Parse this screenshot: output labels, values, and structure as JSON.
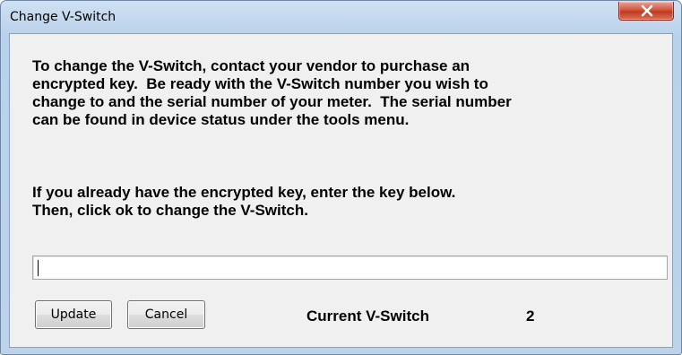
{
  "window": {
    "title": "Change V-Switch",
    "close_icon": "close-x-icon"
  },
  "message": {
    "paragraph1": "To change the V-Switch, contact your vendor to purchase an\nencrypted key.  Be ready with the V-Switch number you wish to\nchange to and the serial number of your meter.  The serial number\ncan be found in device status under the tools menu.",
    "paragraph2": "If you already have the encrypted key, enter the key below.\nThen, click ok to change the V-Switch."
  },
  "key_input": {
    "value": "",
    "placeholder": ""
  },
  "buttons": {
    "update_label": "Update",
    "cancel_label": "Cancel"
  },
  "status": {
    "current_label": "Current V-Switch",
    "current_value": "2"
  },
  "colors": {
    "close_button": "#c9472d",
    "frame": "#b9d1ea",
    "client_background": "#f0f0f0"
  }
}
